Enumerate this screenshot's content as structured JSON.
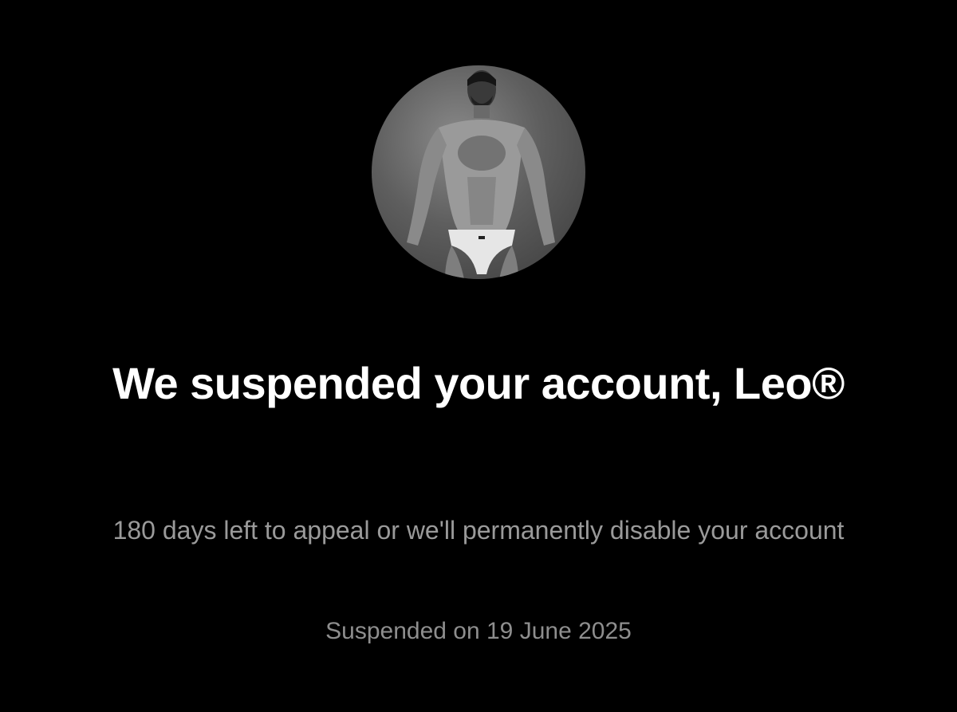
{
  "profile": {
    "avatar_icon": "profile-photo"
  },
  "message": {
    "title": "We suspended your account, Leo®",
    "subtitle": "180 days left to appeal or we'll permanently disable your account",
    "suspended_date": "Suspended on 19 June 2025"
  },
  "colors": {
    "background": "#000000",
    "title": "#ffffff",
    "subtitle": "#9a9a9a",
    "date": "#8e8e8e"
  }
}
